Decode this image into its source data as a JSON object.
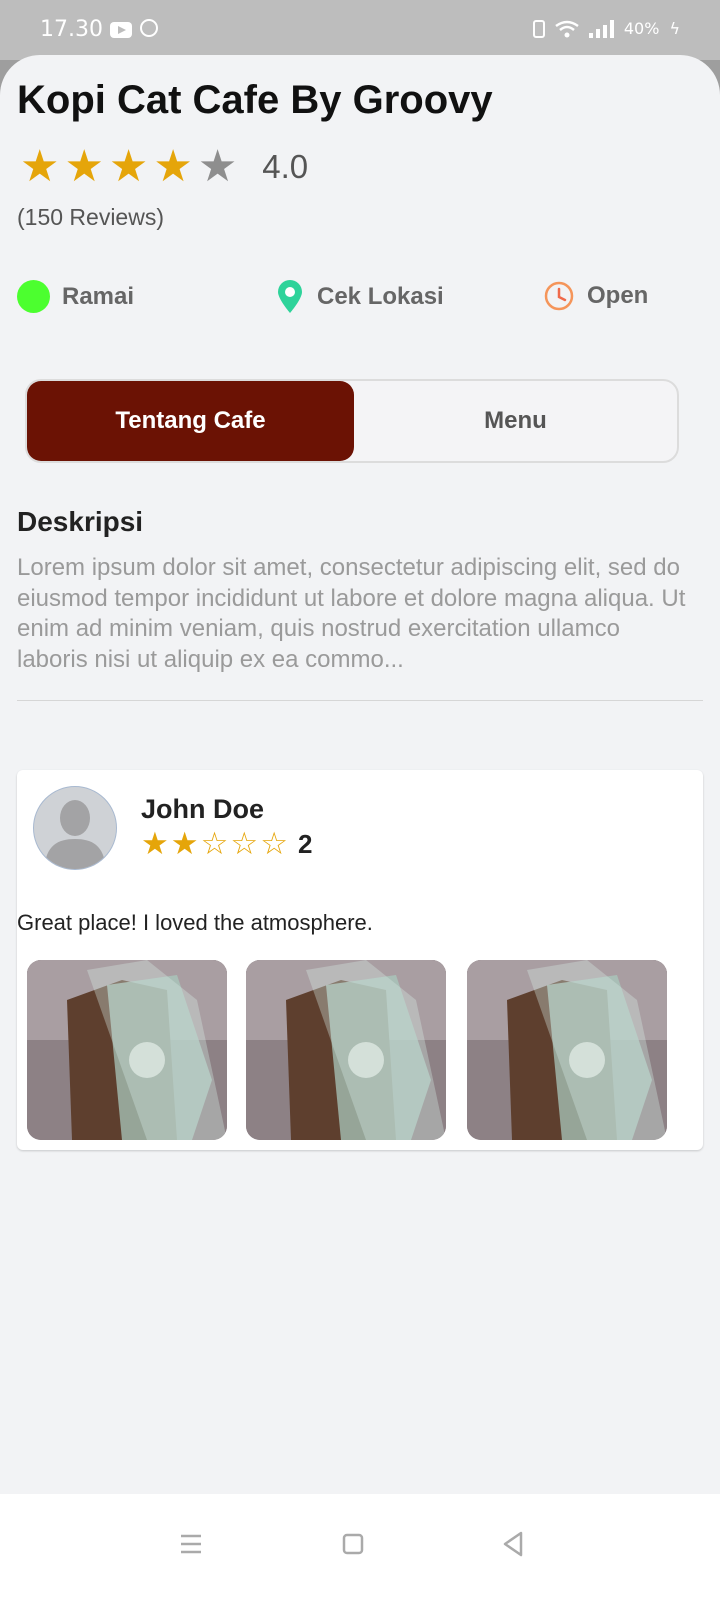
{
  "status_bar": {
    "time": "17.30",
    "battery": "40%",
    "icons": [
      "youtube-icon",
      "whatsapp-icon",
      "vibrate-icon",
      "wifi-icon",
      "signal-icon",
      "battery-charging-icon"
    ]
  },
  "cafe": {
    "name": "Kopi Cat Cafe By Groovy",
    "rating_value": "4.0",
    "rating": 4,
    "max_rating": 5,
    "review_count_text": "(150 Reviews)"
  },
  "info": {
    "crowd": {
      "label": "Ramai",
      "color": "#4cff2f"
    },
    "location": {
      "label": "Cek Lokasi",
      "icon": "location-pin-icon",
      "color": "#2ed39a"
    },
    "hours": {
      "label": "Open",
      "icon": "clock-icon",
      "color": "#f5955a"
    }
  },
  "tabs": {
    "active": "Tentang Cafe",
    "items": [
      "Tentang Cafe",
      "Menu"
    ],
    "active_color": "#6b1204"
  },
  "about": {
    "heading": "Deskripsi",
    "description": "Lorem ipsum dolor sit amet, consectetur adipiscing elit, sed do eiusmod tempor incididunt ut labore et dolore magna aliqua. Ut enim ad minim veniam, quis nostrud exercitation ullamco laboris nisi ut aliquip ex ea commo..."
  },
  "review": {
    "name": "John Doe",
    "rating": 2,
    "max_rating": 5,
    "score_text": "2",
    "text": "Great place! I loved the atmosphere.",
    "photo_count": 3
  },
  "colors": {
    "star": "#e5a50a",
    "background": "#f2f3f5"
  },
  "nav": {
    "icons": [
      "menu-icon",
      "home-icon",
      "back-icon"
    ]
  }
}
